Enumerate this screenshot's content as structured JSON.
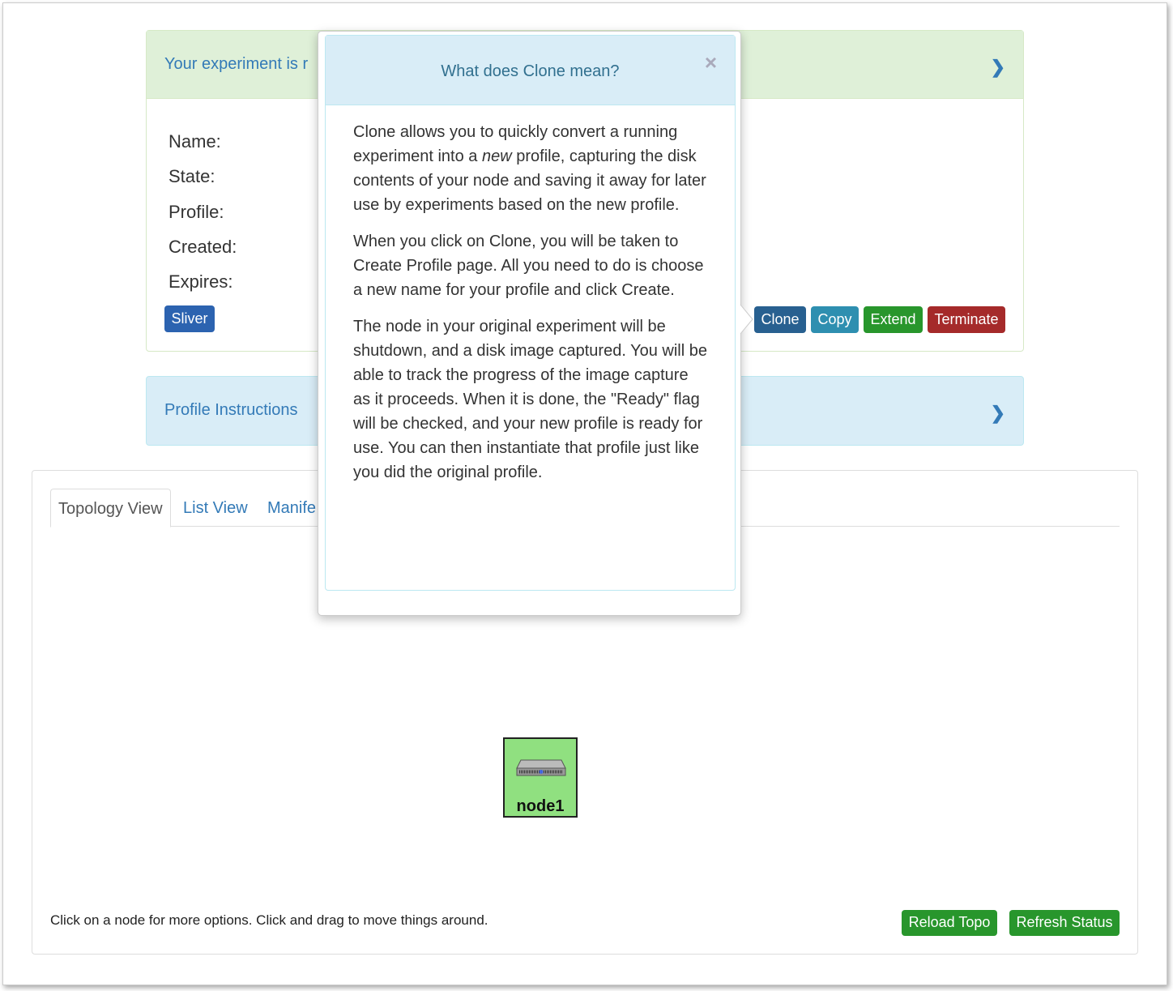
{
  "status_panel": {
    "title": "Your experiment is r",
    "labels": [
      "Name:",
      "State:",
      "Profile:",
      "Created:",
      "Expires:"
    ],
    "sliver_label": "Sliver"
  },
  "actions": {
    "clone": "Clone",
    "copy": "Copy",
    "extend": "Extend",
    "terminate": "Terminate"
  },
  "instructions_panel": {
    "title": "Profile Instructions"
  },
  "tabs": [
    "Topology View",
    "List View",
    "Manife"
  ],
  "topology": {
    "node_label": "node1",
    "hint": "Click on a node for more options. Click and drag to move things around.",
    "reload": "Reload Topo",
    "refresh": "Refresh Status"
  },
  "popover": {
    "title": "What does Clone mean?",
    "close": "×",
    "p1_a": "Clone allows you to quickly convert a running experiment into a ",
    "p1_em": "new",
    "p1_b": " profile, capturing the disk contents of your node and saving it away for later use by experiments based on the new profile.",
    "p2": "When you click on Clone, you will be taken to Create Profile page. All you need to do is choose a new name for your profile and click Create.",
    "p3": "The node in your original experiment will be shutdown, and a disk image captured. You will be able to track the progress of the image capture as it proceeds. When it is done, the \"Ready\" flag will be checked, and your new profile is ready for use. You can then instantiate that profile just like you did the original profile."
  },
  "colors": {
    "success_bg": "#dff0d8",
    "info_bg": "#d9edf7",
    "clone": "#286090",
    "copy": "#31b0d5",
    "extend": "#28962c",
    "terminate": "#a52a2a",
    "node_bg": "#90e080"
  }
}
